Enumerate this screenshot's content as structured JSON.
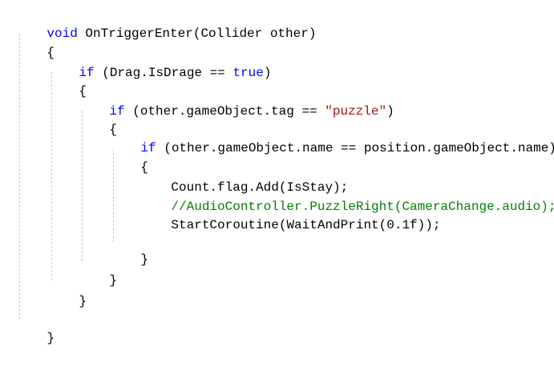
{
  "code": {
    "line1": {
      "kw": "void",
      "text": " OnTriggerEnter(Collider other)"
    },
    "line2": {
      "text": "{"
    },
    "line3": {
      "kw1": "if",
      "text1": " (Drag.IsDrage == ",
      "kw2": "true",
      "text2": ")"
    },
    "line4": {
      "text": "{"
    },
    "line5": {
      "kw": "if",
      "text1": " (other.gameObject.tag == ",
      "str": "\"puzzle\"",
      "text2": ")"
    },
    "line6": {
      "text": "{"
    },
    "line7": {
      "kw": "if",
      "text": " (other.gameObject.name == position.gameObject.name)"
    },
    "line8": {
      "text": "{"
    },
    "line9": {
      "text": "Count.flag.Add(IsStay);"
    },
    "line10": {
      "comment": "//AudioController.PuzzleRight(CameraChange.audio);"
    },
    "line11": {
      "text": "StartCoroutine(WaitAndPrint(0.1f));"
    },
    "line12": {
      "text": "}"
    },
    "line13": {
      "text": "}"
    },
    "line14": {
      "text": "}"
    },
    "line15": {
      "text": "}"
    }
  }
}
